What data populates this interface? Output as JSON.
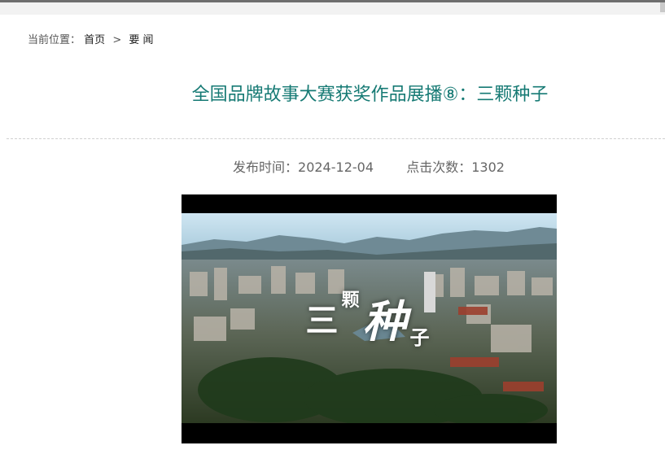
{
  "breadcrumb": {
    "prefix": "当前位置：",
    "items": [
      "首页",
      "要 闻"
    ],
    "separator": ">"
  },
  "article": {
    "title": "全国品牌故事大赛获奖作品展播⑧：三颗种子",
    "publish_label": "发布时间：",
    "publish_date": "2024-12-04",
    "clicks_label": "点击次数：",
    "clicks": "1302"
  },
  "video": {
    "overlay_chars": [
      "三",
      "颗",
      "种",
      "子"
    ]
  },
  "colors": {
    "title": "#167a74",
    "meta": "#666666",
    "divider": "#cfcfcf"
  }
}
